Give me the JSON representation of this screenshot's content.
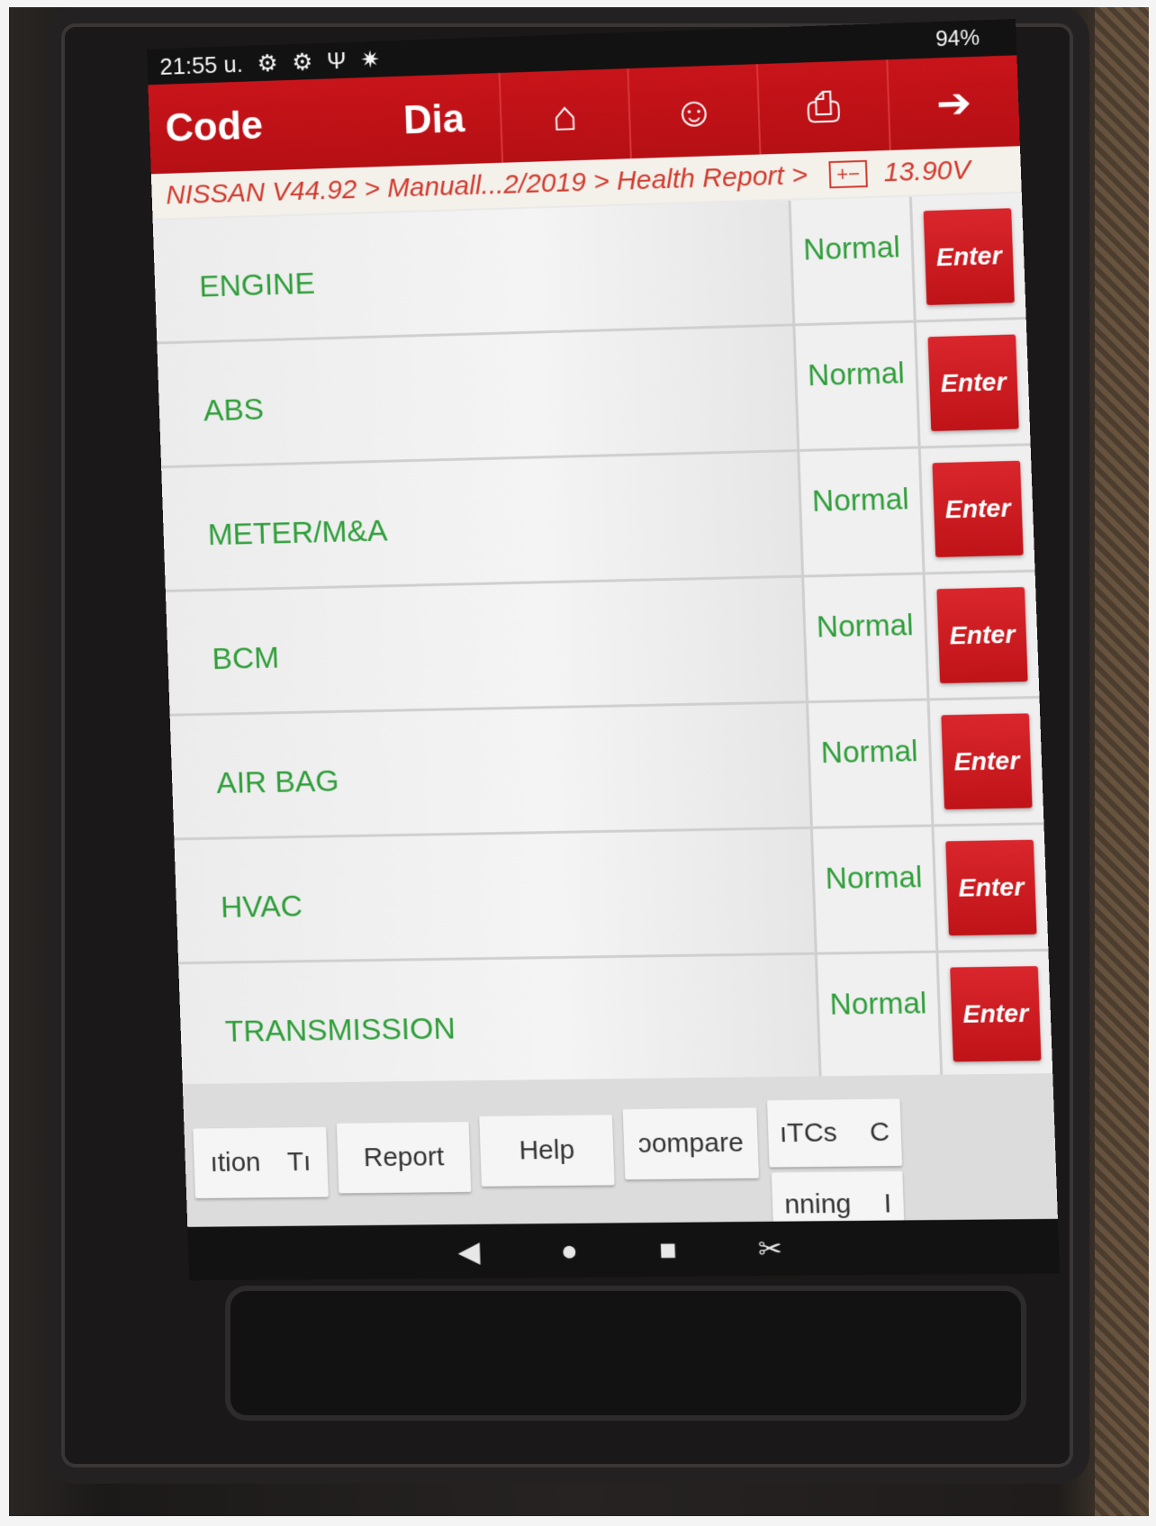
{
  "status_bar": {
    "time": "21:55 u.",
    "icons": [
      "gear-icon",
      "gear-icon",
      "stethoscope-icon",
      "bluetooth-icon"
    ],
    "battery": "94%"
  },
  "toolbar": {
    "tab_code": "Code",
    "tab_diag": "Dia",
    "buttons": [
      "home-icon",
      "support-icon",
      "printer-icon",
      "exit-icon"
    ]
  },
  "breadcrumb": {
    "path": "NISSAN V44.92 > Manuall...2/2019 > Health Report >",
    "voltage": "13.90V"
  },
  "systems": [
    {
      "name": "ENGINE",
      "status": "Normal",
      "action": "Enter"
    },
    {
      "name": "ABS",
      "status": "Normal",
      "action": "Enter"
    },
    {
      "name": "METER/M&A",
      "status": "Normal",
      "action": "Enter"
    },
    {
      "name": "BCM",
      "status": "Normal",
      "action": "Enter"
    },
    {
      "name": "AIR BAG",
      "status": "Normal",
      "action": "Enter"
    },
    {
      "name": "HVAC",
      "status": "Normal",
      "action": "Enter"
    },
    {
      "name": "TRANSMISSION",
      "status": "Normal",
      "action": "Enter"
    }
  ],
  "bottom_buttons": {
    "b1": "ıtion",
    "b1_suffix": "Tı",
    "b2": "Report",
    "b3": "Help",
    "b4": "ɔompare",
    "b5": "ıTCs",
    "b5_suffix": "C",
    "b6": "nning",
    "b6_suffix": "I"
  },
  "nav_bar": [
    "back-icon",
    "home-circle-icon",
    "recents-icon",
    "screenshot-icon"
  ]
}
